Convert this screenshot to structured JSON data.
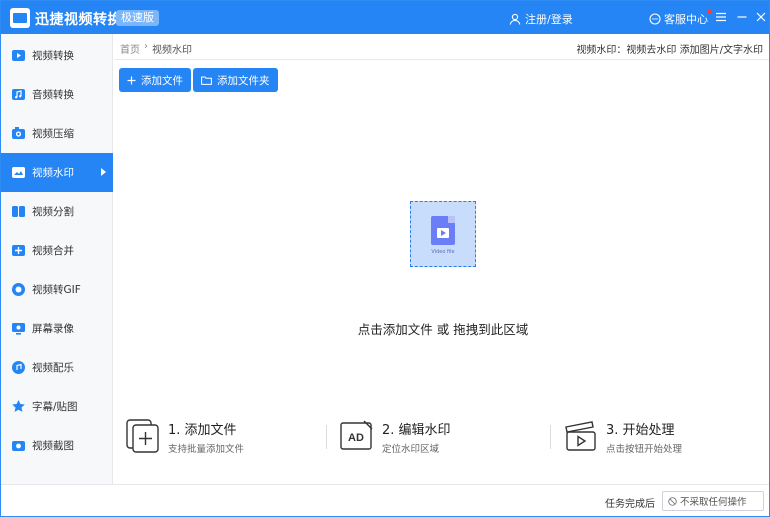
{
  "titlebar": {
    "app_title": "迅捷视频转换器",
    "edition_badge": "极速版",
    "login_label": "注册/登录",
    "service_label": "客服中心"
  },
  "sidebar": {
    "items": [
      {
        "label": "视频转换",
        "icon": "video-convert-icon"
      },
      {
        "label": "音频转换",
        "icon": "audio-convert-icon"
      },
      {
        "label": "视频压缩",
        "icon": "video-compress-icon"
      },
      {
        "label": "视频水印",
        "icon": "video-watermark-icon",
        "active": true
      },
      {
        "label": "视频分割",
        "icon": "video-split-icon"
      },
      {
        "label": "视频合并",
        "icon": "video-merge-icon"
      },
      {
        "label": "视频转GIF",
        "icon": "gif-icon"
      },
      {
        "label": "屏幕录像",
        "icon": "screen-record-icon"
      },
      {
        "label": "视频配乐",
        "icon": "music-icon"
      },
      {
        "label": "字幕/贴图",
        "icon": "subtitle-icon"
      },
      {
        "label": "视频截图",
        "icon": "screenshot-icon"
      }
    ]
  },
  "breadcrumb": {
    "home": "首页",
    "separator": "›",
    "current": "视频水印",
    "right_info": "视频水印：视频去水印 添加图片/文字水印"
  },
  "toolbar": {
    "add_file": "添加文件",
    "add_folder": "添加文件夹"
  },
  "dropzone": {
    "file_caption": "Video file",
    "hint": "点击添加文件 或 拖拽到此区域"
  },
  "steps": [
    {
      "title": "1. 添加文件",
      "desc": "支持批量添加文件"
    },
    {
      "title": "2. 编辑水印",
      "desc": "定位水印区域"
    },
    {
      "title": "3. 开始处理",
      "desc": "点击按钮开始处理"
    }
  ],
  "footer": {
    "after_label": "任务完成后",
    "after_option": "不采取任何操作"
  },
  "colors": {
    "accent": "#2585f5",
    "sidebar_bg": "#f7f8fa",
    "drop_bg": "#c7ddfb",
    "file_icon": "#6a7ef7"
  }
}
